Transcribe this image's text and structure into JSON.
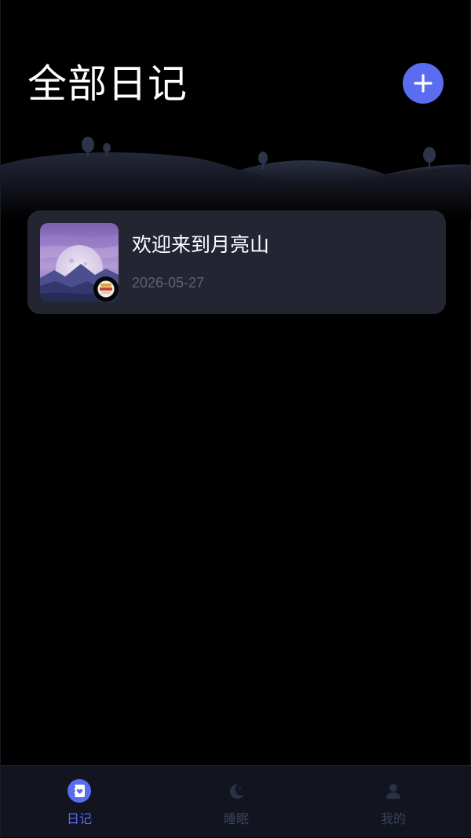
{
  "header": {
    "title": "全部日记",
    "add_icon": "plus-icon"
  },
  "colors": {
    "accent": "#5a6cf0",
    "card_bg": "#232632",
    "tabbar_bg": "#12151f",
    "muted_text": "#5c6273",
    "inactive_tab": "#3a4257"
  },
  "diaries": [
    {
      "title": "欢迎来到月亮山",
      "date": "2026-05-27",
      "thumbnail_icon": "moon-mountain-thumbnail",
      "mood_icon": "mood-emoji-icon"
    }
  ],
  "tabbar": {
    "active": "diary",
    "items": [
      {
        "id": "diary",
        "label": "日记",
        "icon": "diary-heart-icon"
      },
      {
        "id": "sleep",
        "label": "睡眠",
        "icon": "moon-icon"
      },
      {
        "id": "mine",
        "label": "我的",
        "icon": "user-icon"
      }
    ]
  }
}
